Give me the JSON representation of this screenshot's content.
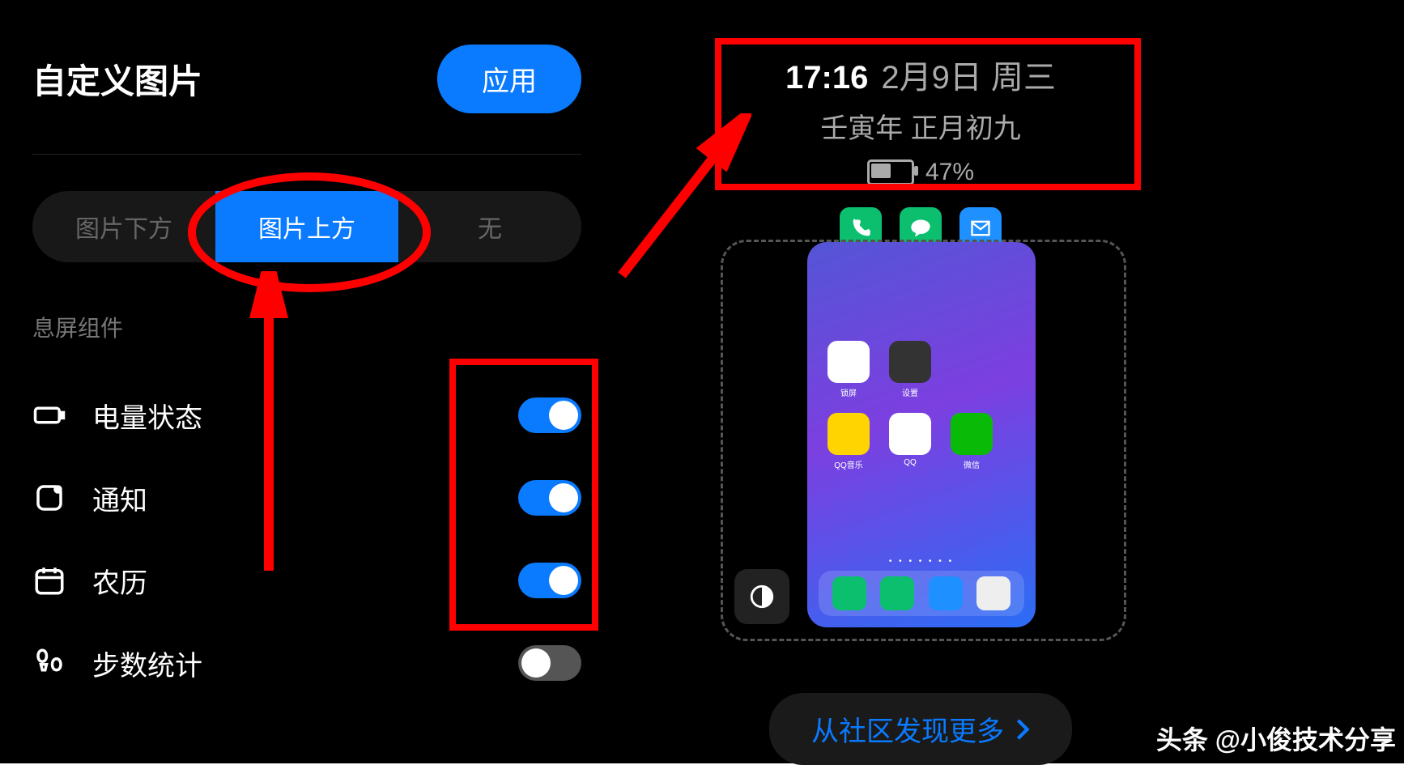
{
  "left": {
    "title": "自定义图片",
    "apply": "应用",
    "segments": {
      "below": "图片下方",
      "above": "图片上方",
      "none": "无",
      "selected": "above"
    },
    "section_label": "息屏组件",
    "rows": {
      "battery": {
        "label": "电量状态",
        "on": true
      },
      "notify": {
        "label": "通知",
        "on": true
      },
      "lunar": {
        "label": "农历",
        "on": true
      },
      "steps": {
        "label": "步数统计",
        "on": false
      }
    }
  },
  "right": {
    "time": "17:16",
    "date": "2月9日 周三",
    "lunar": "壬寅年 正月初九",
    "battery_pct": "47%",
    "preview_apps": {
      "lock": "锁屏",
      "settings": "设置",
      "qqmusic": "QQ音乐",
      "qq": "QQ",
      "wechat": "微信"
    },
    "more_link": "从社区发现更多"
  },
  "watermark": "头条 @小俊技术分享"
}
